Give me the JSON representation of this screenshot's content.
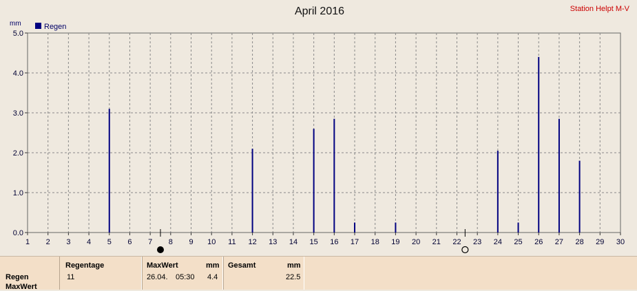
{
  "chart_data": {
    "type": "bar",
    "title": "April 2016",
    "station": "Station Helpt M-V",
    "ylabel": "mm",
    "legend": "Regen",
    "legend_position": "top-left",
    "grid": true,
    "ylim": [
      0,
      5
    ],
    "yticks": [
      "0.0",
      "1.0",
      "2.0",
      "3.0",
      "4.0",
      "5.0"
    ],
    "categories": [
      "1",
      "2",
      "3",
      "4",
      "5",
      "6",
      "7",
      "8",
      "9",
      "10",
      "11",
      "12",
      "13",
      "14",
      "15",
      "16",
      "17",
      "18",
      "19",
      "20",
      "21",
      "22",
      "23",
      "24",
      "25",
      "26",
      "27",
      "28",
      "29",
      "30"
    ],
    "values": [
      0,
      0,
      0,
      0,
      3.1,
      0,
      0,
      0,
      0,
      0,
      0,
      2.1,
      0,
      0,
      2.6,
      2.85,
      0.25,
      0,
      0.25,
      0,
      0,
      0,
      0,
      2.05,
      0.25,
      4.4,
      2.85,
      1.8,
      0,
      0
    ],
    "moon_phases": [
      {
        "phase": "full-moon",
        "day": 7.5
      },
      {
        "phase": "new-moon",
        "day": 22.4
      }
    ],
    "bar_color": "#000080"
  },
  "summary": {
    "rows": [
      "Regen",
      "MaxWert"
    ],
    "regentage": {
      "header": "Regentage",
      "value": "11"
    },
    "maxwert": {
      "header": "MaxWert",
      "unit": "mm",
      "date": "26.04.",
      "time": "05:30",
      "value": "4.4"
    },
    "gesamt": {
      "header": "Gesamt",
      "unit": "mm",
      "value": "22.5"
    }
  }
}
